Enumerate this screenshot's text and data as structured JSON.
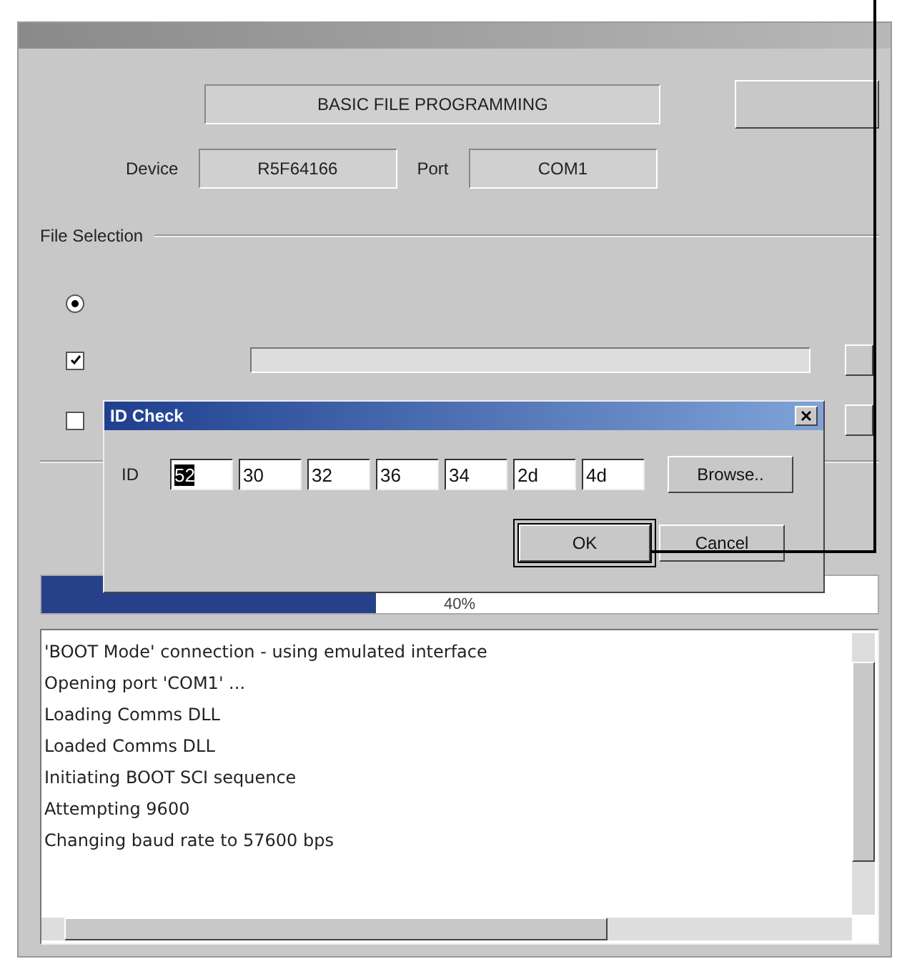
{
  "window": {
    "header": "BASIC FILE PROGRAMMING",
    "device_label": "Device",
    "device": "R5F64166",
    "port_label": "Port",
    "port": "COM1",
    "file_selection": {
      "title": "File Selection",
      "options": [
        {
          "kind": "radio",
          "selected": true
        },
        {
          "kind": "checkbox",
          "checked": true
        },
        {
          "kind": "checkbox",
          "checked": false
        }
      ]
    },
    "progress": {
      "level": 0.4,
      "reading": "40%"
    },
    "log": [
      "'BOOT Mode' connection - using emulated interface",
      "Opening port 'COM1' ...",
      "Loading Comms DLL",
      "Loaded Comms DLL",
      "Initiating BOOT SCI sequence",
      "Attempting 9600",
      "Changing baud rate to 57600 bps"
    ]
  },
  "dialog": {
    "title": "ID Check",
    "id_label": "ID",
    "id_fields": [
      {
        "value": "52",
        "selected": true
      },
      {
        "value": "30",
        "selected": false
      },
      {
        "value": "32",
        "selected": false
      },
      {
        "value": "36",
        "selected": false
      },
      {
        "value": "34",
        "selected": false
      },
      {
        "value": "2d",
        "selected": false
      },
      {
        "value": "4d",
        "selected": false
      }
    ],
    "buttons": [
      {
        "kind": "browse",
        "label": "Browse..",
        "default": false
      },
      {
        "kind": "ok",
        "label": "OK",
        "default": true
      },
      {
        "kind": "cancel",
        "label": "Cancel",
        "default": false
      }
    ]
  }
}
